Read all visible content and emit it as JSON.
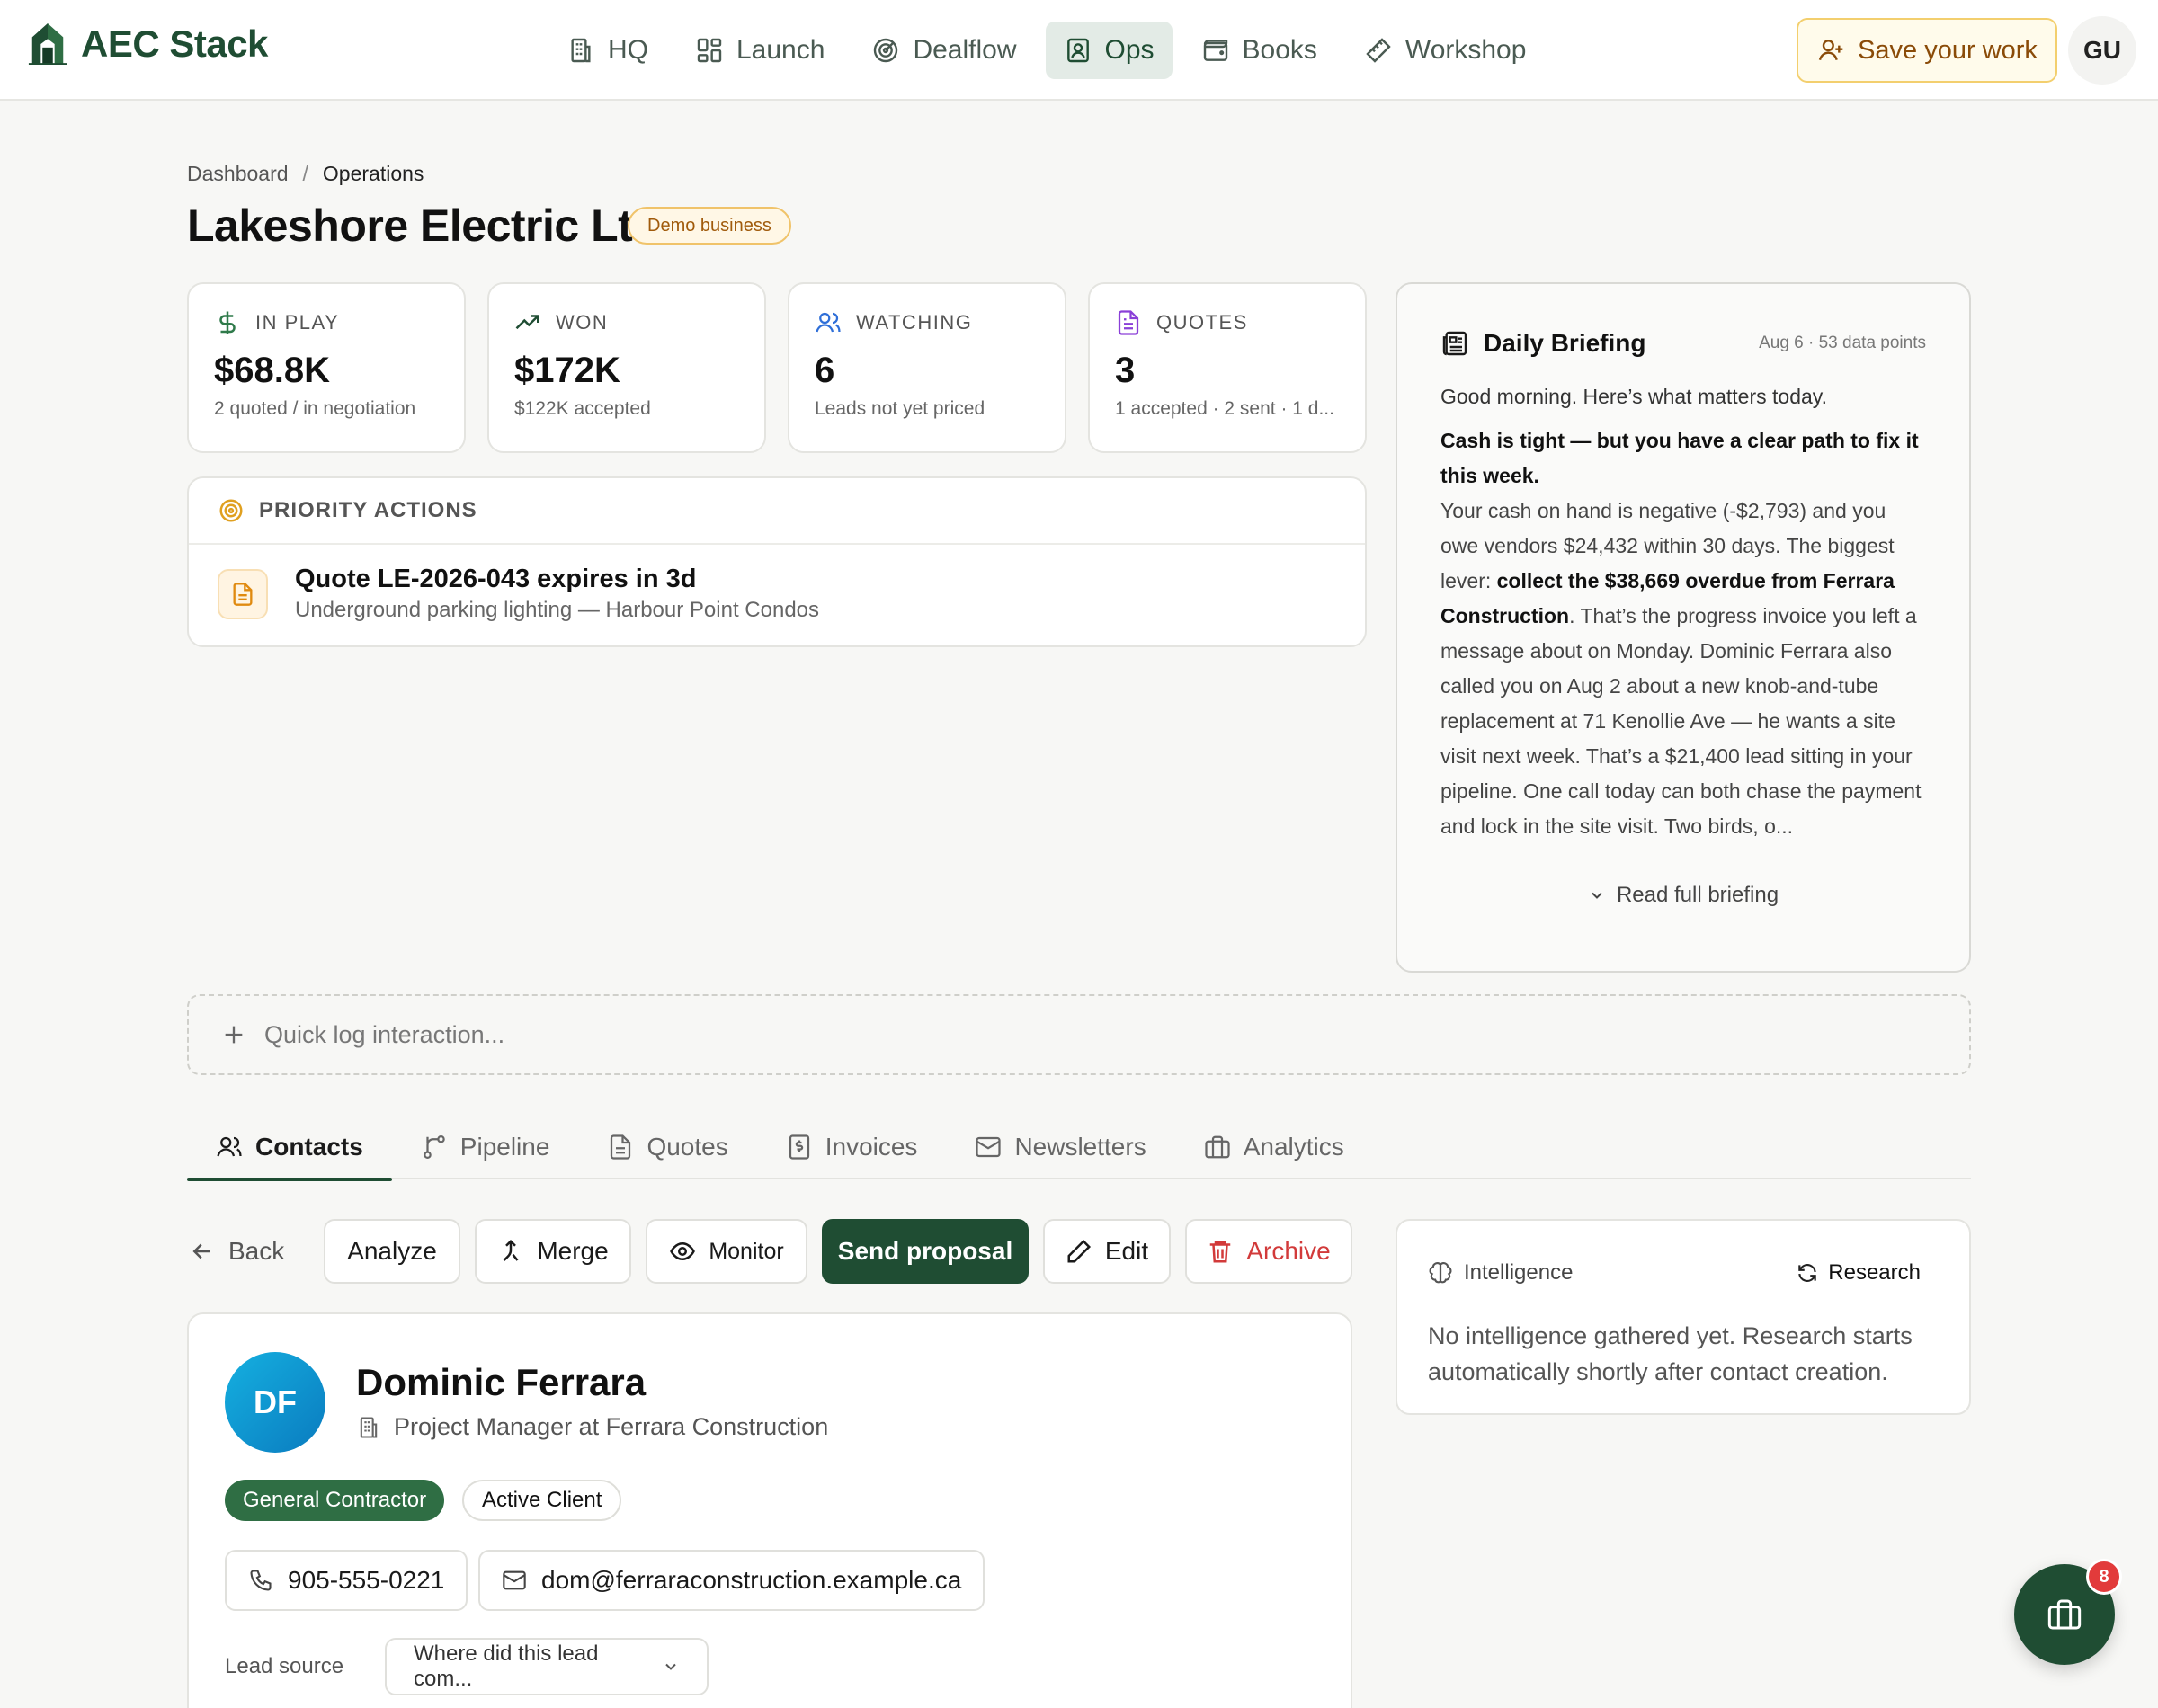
{
  "app": {
    "name": "AEC Stack"
  },
  "nav": {
    "items": [
      {
        "label": "HQ",
        "icon": "building-icon"
      },
      {
        "label": "Launch",
        "icon": "grid-icon"
      },
      {
        "label": "Dealflow",
        "icon": "radar-icon"
      },
      {
        "label": "Ops",
        "icon": "contact-icon",
        "active": true
      },
      {
        "label": "Books",
        "icon": "wallet-icon"
      },
      {
        "label": "Workshop",
        "icon": "ruler-icon"
      }
    ],
    "save_label": "Save your work",
    "user_initials": "GU"
  },
  "breadcrumb": {
    "root": "Dashboard",
    "sep": "/",
    "current": "Operations"
  },
  "page": {
    "title": "Lakeshore Electric Ltd.",
    "badge": "Demo business"
  },
  "stats": [
    {
      "label": "IN PLAY",
      "value": "$68.8K",
      "sub": "2 quoted / in negotiation",
      "icon": "dollar-icon",
      "color": "#2f7a4a"
    },
    {
      "label": "WON",
      "value": "$172K",
      "sub": "$122K accepted",
      "icon": "trending-up-icon",
      "color": "#1f4d33"
    },
    {
      "label": "WATCHING",
      "value": "6",
      "sub": "Leads not yet priced",
      "icon": "users-icon",
      "color": "#2f6fd8"
    },
    {
      "label": "QUOTES",
      "value": "3",
      "sub": "1 accepted · 2 sent · 1 d...",
      "icon": "document-icon",
      "color": "#8a3fd8"
    }
  ],
  "priority": {
    "heading": "PRIORITY ACTIONS",
    "items": [
      {
        "title": "Quote LE-2026-043 expires in 3d",
        "subtitle": "Underground parking lighting — Harbour Point Condos"
      }
    ]
  },
  "briefing": {
    "title": "Daily Briefing",
    "meta": "Aug 6 · 53 data points",
    "greeting": "Good morning. Here’s what matters today.",
    "headline": "Cash is tight — but you have a clear path to fix it this week.",
    "body_1": "Your cash on hand is negative (-$2,793) and you owe vendors $24,432 within 30 days. The biggest lever: ",
    "body_bold": "collect the $38,669 overdue from Ferrara Construction",
    "body_2": ". That’s the progress invoice you left a message about on Monday. Dominic Ferrara also called you on Aug 2 about a new knob-and-tube replacement at 71 Kenollie Ave — he wants a site visit next week. That’s a $21,400 lead sitting in your pipeline. One call today can both chase the payment and lock in the site visit. Two birds, o...",
    "read_more": "Read full briefing"
  },
  "quicklog": {
    "placeholder": "Quick log interaction..."
  },
  "tabs": [
    {
      "label": "Contacts",
      "icon": "users-icon",
      "active": true
    },
    {
      "label": "Pipeline",
      "icon": "branch-icon"
    },
    {
      "label": "Quotes",
      "icon": "document-icon"
    },
    {
      "label": "Invoices",
      "icon": "invoice-icon"
    },
    {
      "label": "Newsletters",
      "icon": "mail-icon"
    },
    {
      "label": "Analytics",
      "icon": "briefcase-icon"
    }
  ],
  "actions": {
    "back": "Back",
    "analyze": "Analyze",
    "merge": "Merge",
    "monitor": "Monitor",
    "send_proposal": "Send proposal",
    "edit": "Edit",
    "archive": "Archive"
  },
  "contact": {
    "initials": "DF",
    "name": "Dominic Ferrara",
    "role": "Project Manager at Ferrara Construction",
    "tags": [
      "General Contractor",
      "Active Client"
    ],
    "phone": "905-555-0221",
    "email": "dom@ferraraconstruction.example.ca",
    "lead_source_label": "Lead source",
    "lead_source_placeholder": "Where did this lead com..."
  },
  "intelligence": {
    "title": "Intelligence",
    "research": "Research",
    "empty": "No intelligence gathered yet. Research starts automatically shortly after contact creation."
  },
  "fab": {
    "badge": "8",
    "icon": "briefcase-icon"
  },
  "colors": {
    "brand": "#1f4d33",
    "accent_warn": "#f3cf6e",
    "danger": "#d23a3a"
  }
}
